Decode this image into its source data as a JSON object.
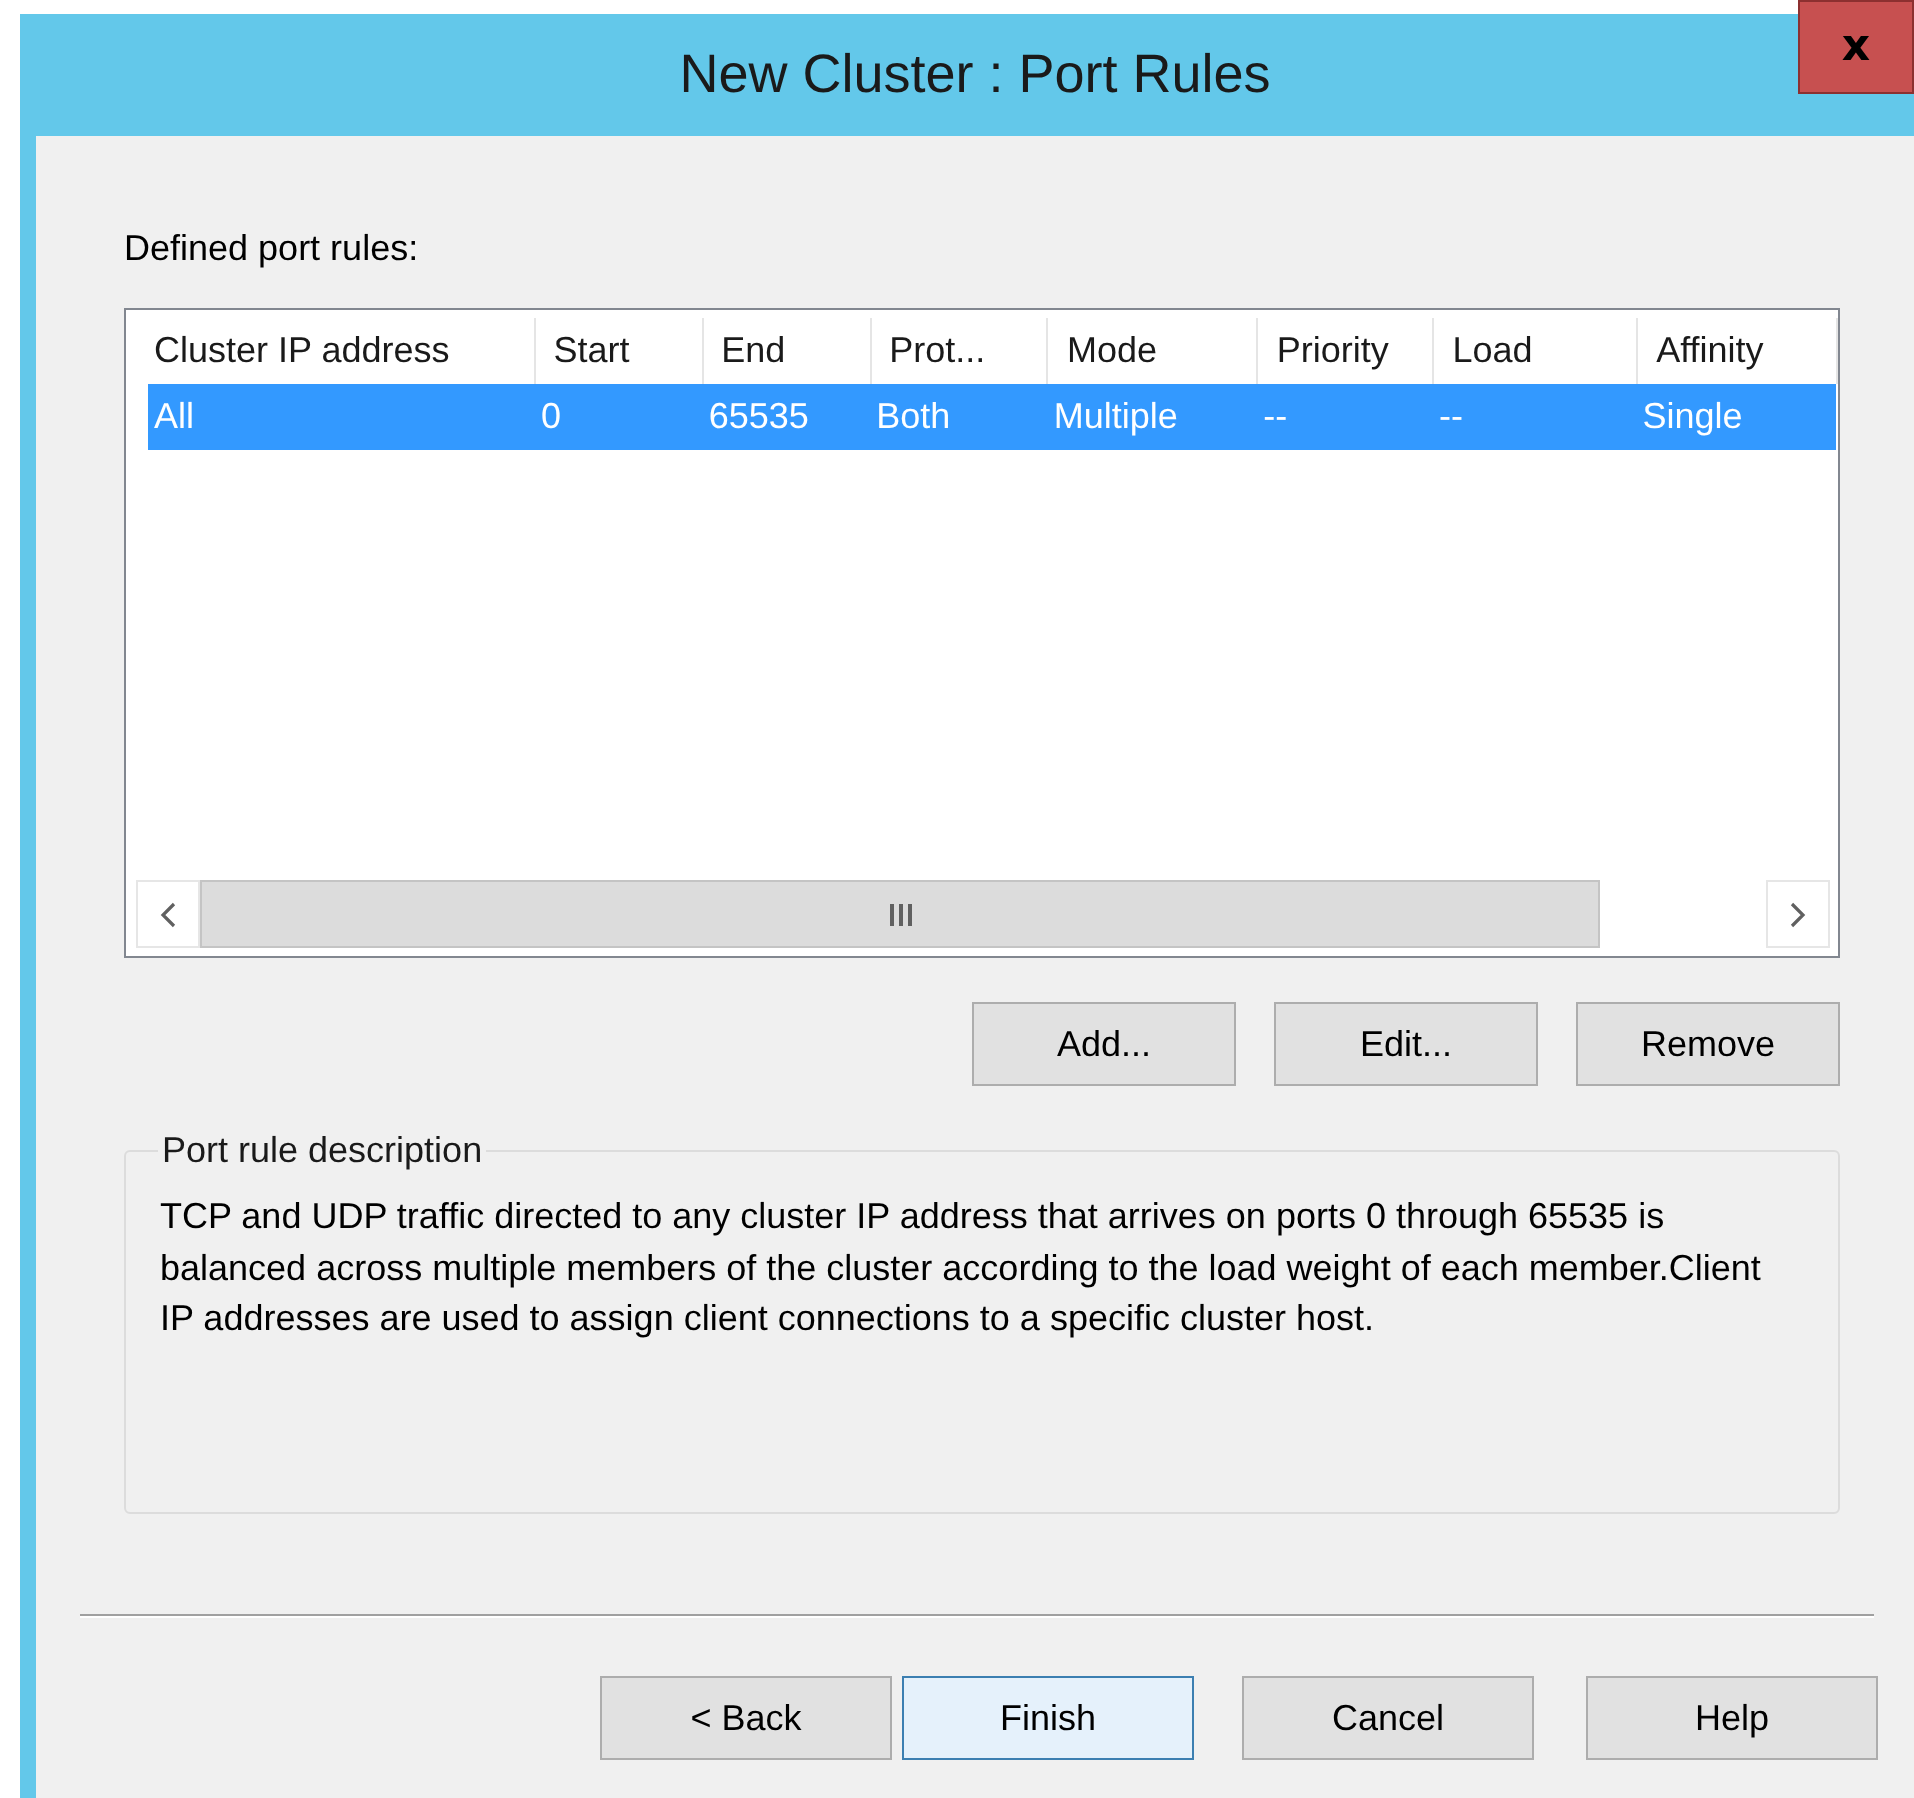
{
  "window": {
    "title": "New Cluster :  Port Rules",
    "close": "x"
  },
  "rules_label": "Defined port rules:",
  "table": {
    "columns": [
      "Cluster IP address",
      "Start",
      "End",
      "Prot...",
      "Mode",
      "Priority",
      "Load",
      "Affinity"
    ],
    "rows": [
      {
        "cells": [
          "All",
          "0",
          "65535",
          "Both",
          "Multiple",
          "--",
          "--",
          "Single"
        ],
        "selected": true
      }
    ]
  },
  "rule_buttons": [
    "Add...",
    "Edit...",
    "Remove"
  ],
  "description": {
    "title": "Port rule description",
    "text": "TCP and UDP traffic directed to any cluster IP address that arrives on ports 0 through 65535 is balanced across multiple members of the cluster according to the load weight of each member.Client IP addresses are used to assign client connections to a specific cluster host."
  },
  "buttons": [
    {
      "label": "< Back",
      "default": false
    },
    {
      "label": "Finish",
      "default": true
    },
    {
      "label": "Cancel",
      "default": false
    },
    {
      "label": "Help",
      "default": false
    }
  ]
}
